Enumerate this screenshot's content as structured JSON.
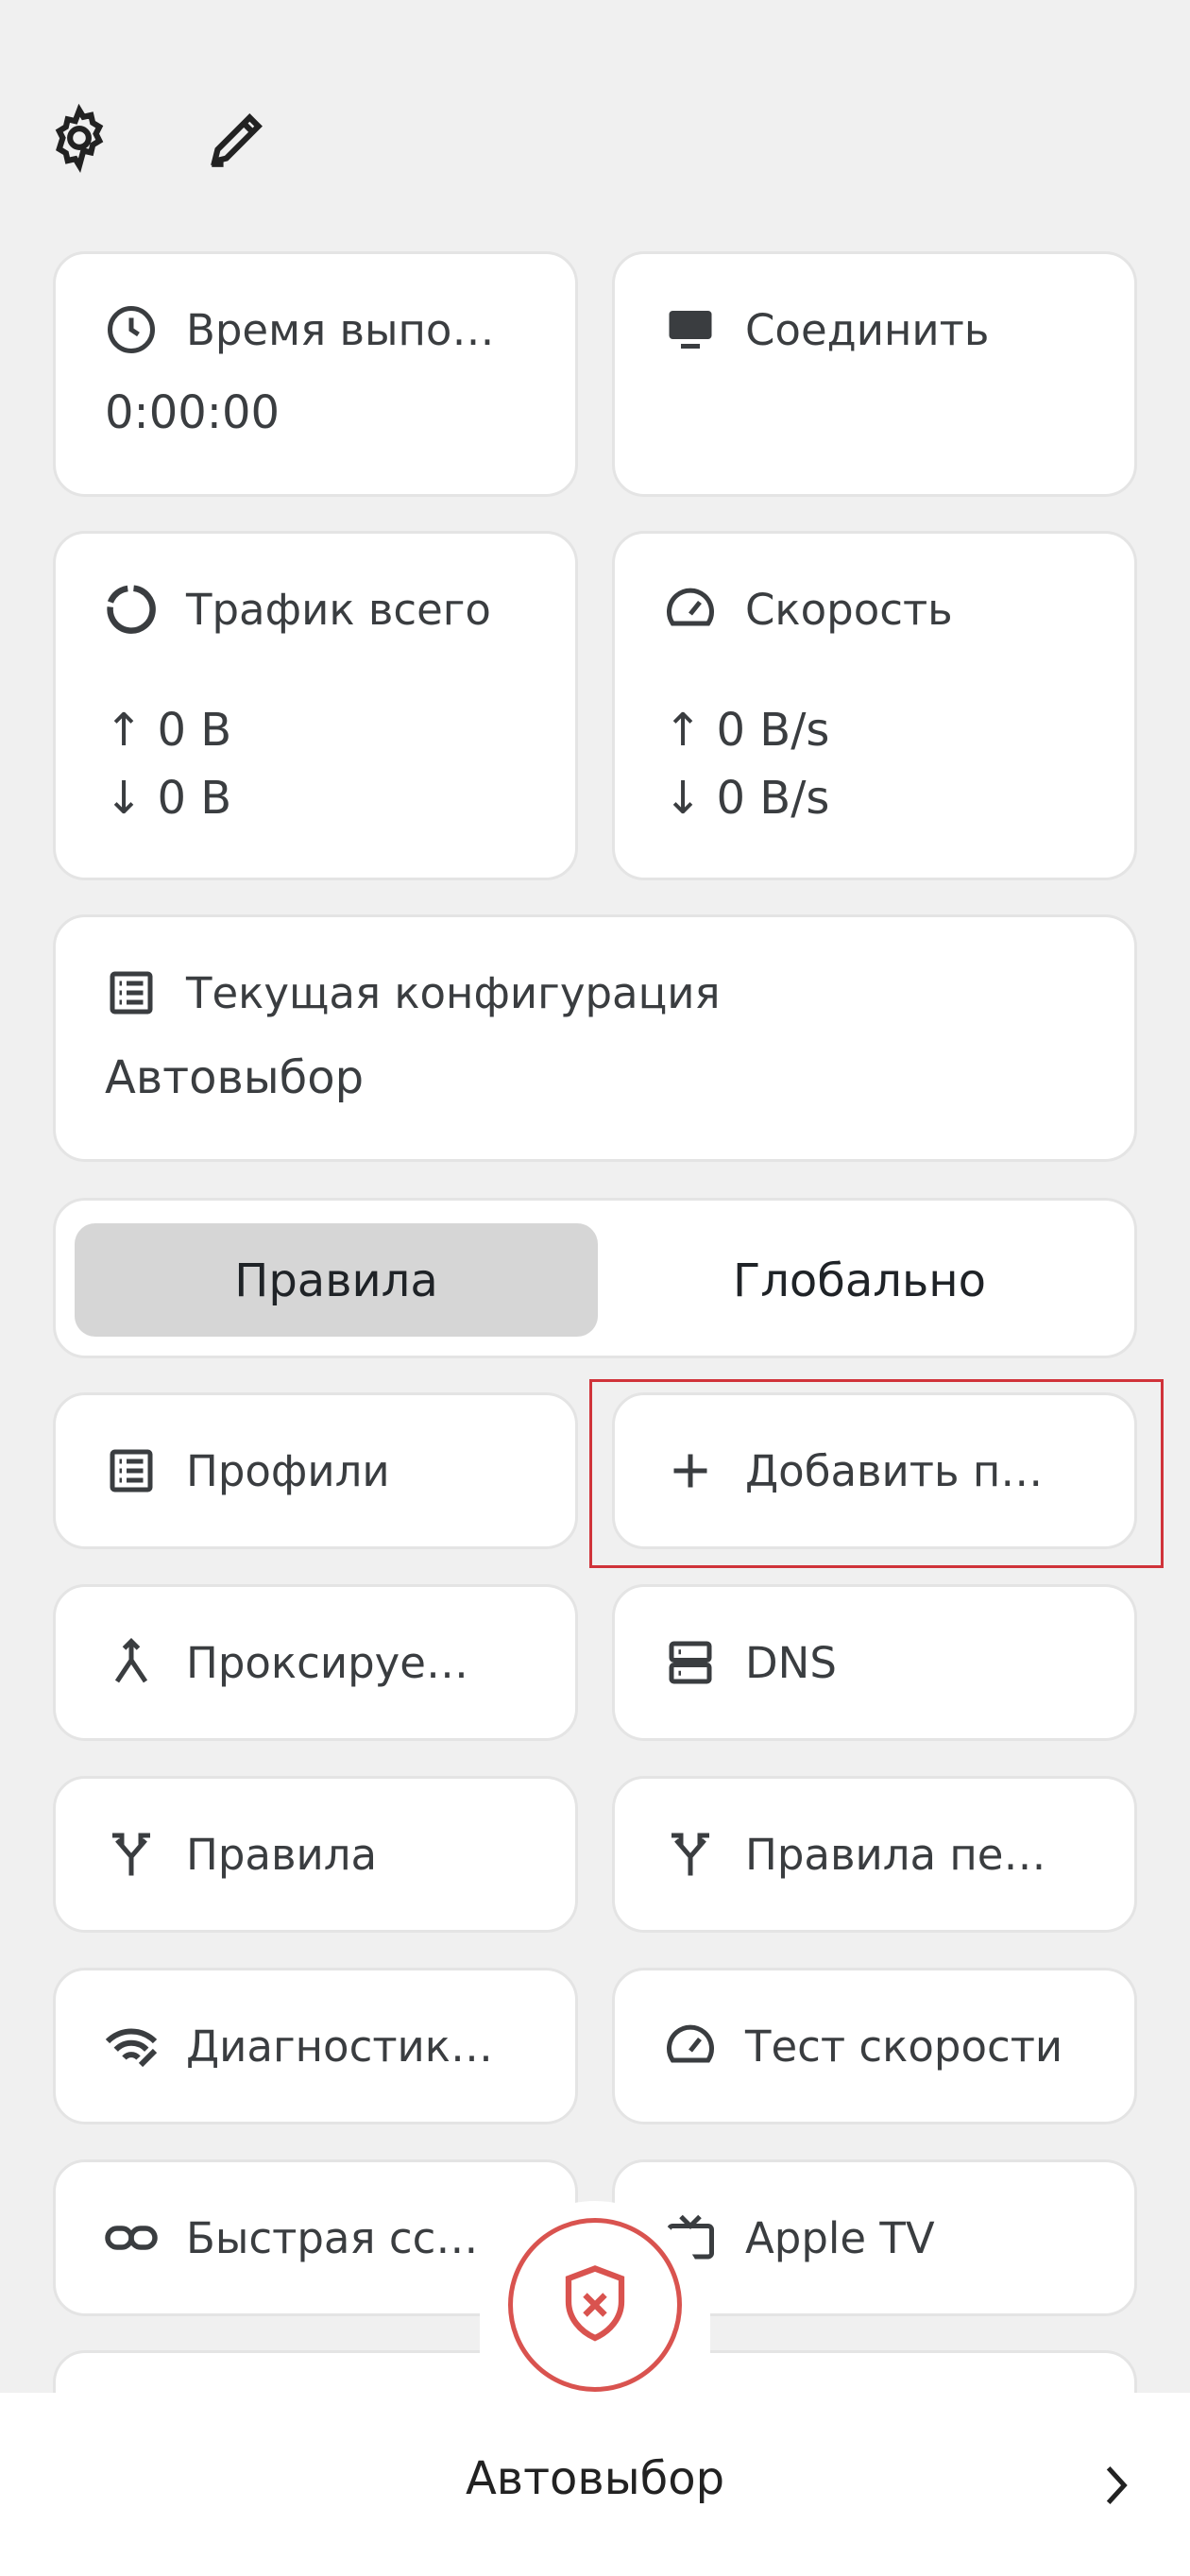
{
  "toolbar": {
    "settings_icon": "gear-icon",
    "edit_icon": "pencil-icon"
  },
  "cards": {
    "runtime": {
      "title": "Время выпо…",
      "value": "0:00:00",
      "icon": "clock-icon"
    },
    "connect": {
      "title": "Соединить",
      "icon": "monitor-icon"
    },
    "traffic": {
      "title": "Трафик всего",
      "up": "↑  0 B",
      "down": "↓  0 B",
      "icon": "donut-icon"
    },
    "speed": {
      "title": "Скорость",
      "up": "↑  0 B/s",
      "down": "↓  0 B/s",
      "icon": "speedometer-icon"
    },
    "config": {
      "title": "Текущая конфигурация",
      "value": "Автовыбор",
      "icon": "list-icon"
    }
  },
  "mode": {
    "rules_label": "Правила",
    "global_label": "Глобально",
    "selected": "Правила"
  },
  "grid": {
    "profiles": "Профили",
    "add_profile": "Добавить п…",
    "proxied": "Проксируе…",
    "dns": "DNS",
    "rules": "Правила",
    "rules_override": "Правила пе…",
    "diagnostics": "Диагностик…",
    "speed_test": "Тест скорости",
    "quick_link": "Быстрая сс…",
    "apple_tv": "Apple TV"
  },
  "bottom": {
    "label": "Автовыбор",
    "status_icon": "shield-x-icon",
    "chevron": "chevron-right-icon"
  },
  "colors": {
    "accent_red": "#d9534f",
    "highlight": "#d0333a"
  }
}
